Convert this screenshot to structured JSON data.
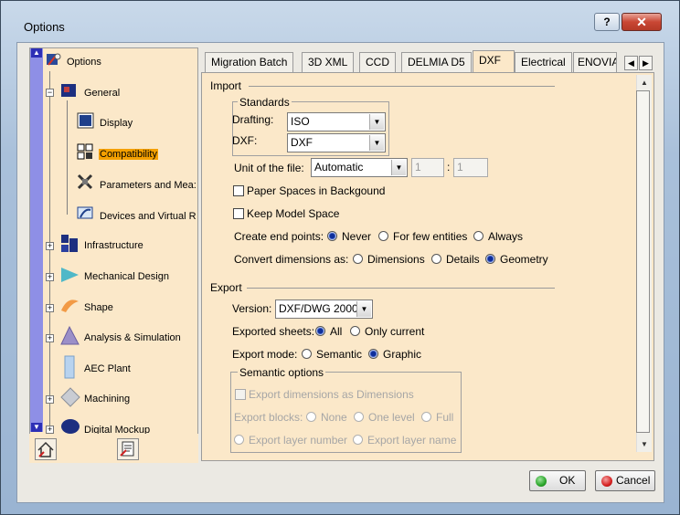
{
  "window": {
    "title": "Options",
    "help_label": "?",
    "close_label": "✕"
  },
  "tree": {
    "items": [
      {
        "label": "Options",
        "icon": "options-icon"
      },
      {
        "label": "General",
        "icon": "general-icon"
      },
      {
        "label": "Display",
        "icon": "display-icon"
      },
      {
        "label": "Compatibility",
        "icon": "compatibility-icon"
      },
      {
        "label": "Parameters and Mea:",
        "icon": "parameters-icon"
      },
      {
        "label": "Devices and Virtual R",
        "icon": "devices-icon"
      },
      {
        "label": "Infrastructure",
        "icon": "infrastructure-icon"
      },
      {
        "label": "Mechanical Design",
        "icon": "mechanical-design-icon"
      },
      {
        "label": "Shape",
        "icon": "shape-icon"
      },
      {
        "label": "Analysis & Simulation",
        "icon": "analysis-icon"
      },
      {
        "label": "AEC Plant",
        "icon": "aec-plant-icon"
      },
      {
        "label": "Machining",
        "icon": "machining-icon"
      },
      {
        "label": "Digital Mockup",
        "icon": "digital-mockup-icon"
      }
    ],
    "selected": "Compatibility"
  },
  "tabs": [
    "Migration Batch",
    "3D XML",
    "CCD",
    "DELMIA D5",
    "DXF",
    "Electrical",
    "ENOVIA"
  ],
  "active_tab": "DXF",
  "import": {
    "label": "Import",
    "standards_label": "Standards",
    "drafting_label": "Drafting:",
    "drafting_value": "ISO",
    "dxf_label": "DXF:",
    "dxf_value": "DXF",
    "unit_label": "Unit of the file:",
    "unit_value": "Automatic",
    "unit_num1": "1",
    "unit_sep": ":",
    "unit_num2": "1",
    "paper_spaces_label": "Paper Spaces in Backgound",
    "keep_model_label": "Keep Model Space",
    "end_points_label": "Create end points:",
    "end_points_options": [
      "Never",
      "For few entities",
      "Always"
    ],
    "end_points_selected": "Never",
    "convert_label": "Convert dimensions as:",
    "convert_options": [
      "Dimensions",
      "Details",
      "Geometry"
    ],
    "convert_selected": "Geometry"
  },
  "export": {
    "label": "Export",
    "version_label": "Version:",
    "version_value": "DXF/DWG 2000",
    "sheets_label": "Exported sheets:",
    "sheets_options": [
      "All",
      "Only current"
    ],
    "sheets_selected": "All",
    "mode_label": "Export mode:",
    "mode_options": [
      "Semantic",
      "Graphic"
    ],
    "mode_selected": "Graphic",
    "semantic_group_label": "Semantic options",
    "semantic_dims_label": "Export dimensions as Dimensions",
    "blocks_label": "Export blocks:",
    "blocks_options": [
      "None",
      "One level",
      "Full"
    ],
    "layer_options": [
      "Export layer number",
      "Export layer name"
    ]
  },
  "buttons": {
    "ok": "OK",
    "cancel": "Cancel"
  },
  "colors": {
    "panel": "#fbe8c9",
    "selected_highlight": "#f4a000",
    "ok_dot": "#2aa52a",
    "cancel_dot": "#d62020"
  }
}
